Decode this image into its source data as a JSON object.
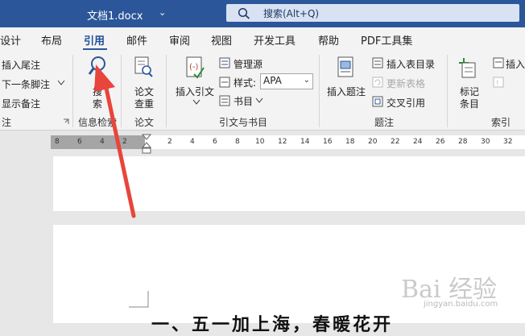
{
  "titlebar": {
    "doc_title": "文档1.docx",
    "caret": "⌄",
    "search_placeholder": "搜索(Alt+Q)"
  },
  "tabs": [
    "设计",
    "布局",
    "引用",
    "邮件",
    "审阅",
    "视图",
    "开发工具",
    "帮助",
    "PDF工具集"
  ],
  "active_tab": "引用",
  "ribbon": {
    "footnotes": {
      "insert_endnote": "插入尾注",
      "next_footnote": "下一条脚注",
      "show_notes": "显示备注",
      "label": "注"
    },
    "research": {
      "search_top": "搜",
      "search_bottom": "索",
      "label": "信息检索"
    },
    "paper": {
      "top": "论文",
      "bottom": "查重",
      "label": "论文"
    },
    "citations": {
      "insert_top": "插入引文",
      "manage_sources": "管理源",
      "style_label": "样式:",
      "style_value": "APA",
      "bibliography": "书目",
      "label": "引文与书目"
    },
    "captions": {
      "insert_caption": "插入题注",
      "insert_tof": "插入表目录",
      "update_table": "更新表格",
      "cross_ref": "交叉引用",
      "label": "题注"
    },
    "index": {
      "mark_top": "标记",
      "mark_bottom": "条目",
      "insert_index": "插入",
      "label": "索引"
    }
  },
  "ruler": {
    "left_numbers": [
      "8",
      "6",
      "4",
      "2",
      "2"
    ],
    "right_numbers": [
      "2",
      "4",
      "6",
      "8",
      "10",
      "12",
      "14",
      "16",
      "18",
      "20",
      "22",
      "24",
      "26",
      "28",
      "30",
      "32"
    ]
  },
  "document": {
    "heading": "一、五一加上海，春暖花开"
  },
  "watermark": {
    "main": "Bai 经验",
    "sub": "jingyan.baidu.com"
  },
  "colors": {
    "title_blue": "#2b579a",
    "annotation_red": "#e8453c"
  }
}
